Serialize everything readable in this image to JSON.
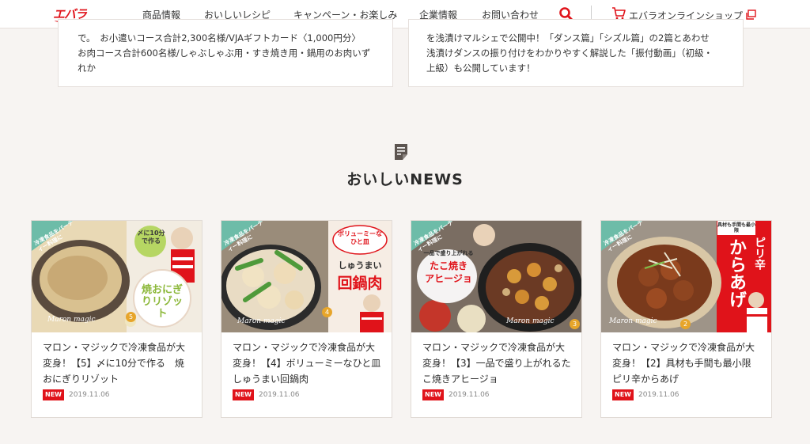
{
  "header": {
    "logo": "エバラ",
    "nav": [
      "商品情報",
      "おいしいレシピ",
      "キャンペーン・お楽しみ",
      "企業情報",
      "お問い合わせ"
    ],
    "shop_label": "エバラオンラインショップ",
    "icons": {
      "search": "search-icon",
      "cart": "cart-icon",
      "external": "external-link-icon"
    },
    "accent": "#e0131a"
  },
  "top_cards": [
    {
      "lines": [
        "で。　お小遣いコース合計2,300名様/VJAギフトカード〈1,000円分〉",
        "お肉コース合計600名様/しゃぶしゃぶ用・すき焼き用・鍋用のお肉いず",
        "れか"
      ]
    },
    {
      "lines": [
        "を浅漬けマルシェで公開中！「ダンス篇」「シズル篇」の2篇とあわせ",
        "浅漬けダンスの振り付けをわかりやすく解説した「振付動画」（初級・",
        "上級）も公開しています！"
      ]
    }
  ],
  "section": {
    "title": "おいしいNEWS",
    "icon": "document-icon"
  },
  "cards": [
    {
      "title": "マロン・マジックで冷凍食品が大変身！【5】〆に10分で作る　焼おにぎりリゾット",
      "badge": "NEW",
      "date": "2019.11.06",
      "thumb": {
        "corner": "冷凍食品をパーティー料理に",
        "bubble": "〆に10分で作る",
        "dish": "焼おにぎりリゾット",
        "num": "5",
        "sig": "Maron magic"
      }
    },
    {
      "title": "マロン・マジックで冷凍食品が大変身！【4】ボリューミーなひと皿　しゅうまい回鍋肉",
      "badge": "NEW",
      "date": "2019.11.06",
      "thumb": {
        "corner": "冷凍食品をパーティー料理に",
        "bubble": "ボリューミーなひと皿",
        "sub": "しゅうまい",
        "dish": "回鍋肉",
        "num": "4",
        "sig": "Maron magic"
      }
    },
    {
      "title": "マロン・マジックで冷凍食品が大変身！【3】一品で盛り上がれるたこ焼きアヒージョ",
      "badge": "NEW",
      "date": "2019.11.06",
      "thumb": {
        "corner": "冷凍食品をパーティー料理に",
        "bubble": "一品で盛り上がれる",
        "dish": "たこ焼き",
        "dish2": "アヒージョ",
        "num": "3",
        "sig": "Maron magic"
      }
    },
    {
      "title": "マロン・マジックで冷凍食品が大変身！【2】具材も手間も最小限　ピリ辛からあげ",
      "badge": "NEW",
      "date": "2019.11.06",
      "thumb": {
        "corner": "冷凍食品をパーティー料理に",
        "bubble": "具材も手間も最小限",
        "sub": "ピリ辛",
        "dish": "からあげ",
        "num": "2",
        "sig": "Maron magic"
      }
    }
  ]
}
